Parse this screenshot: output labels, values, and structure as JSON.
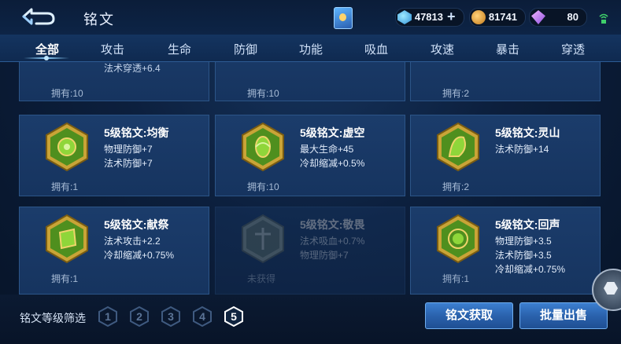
{
  "header": {
    "title": "铭文",
    "currency": [
      {
        "icon": "diamond-icon",
        "value": "47813"
      },
      {
        "icon": "gold-coin-icon",
        "value": "81741"
      },
      {
        "icon": "gem-icon",
        "value": "80"
      }
    ]
  },
  "tabs": [
    "全部",
    "攻击",
    "生命",
    "防御",
    "功能",
    "吸血",
    "攻速",
    "暴击",
    "穿透"
  ],
  "cards_top_partial": [
    {
      "stat": "法术穿透+6.4",
      "owned": "拥有:10"
    },
    {
      "owned": "拥有:10"
    },
    {
      "owned": "拥有:2"
    }
  ],
  "cards": [
    {
      "title": "5级铭文:均衡",
      "stats": [
        "物理防御+7",
        "法术防御+7"
      ],
      "owned": "拥有:1"
    },
    {
      "title": "5级铭文:虚空",
      "stats": [
        "最大生命+45",
        "冷却缩减+0.5%"
      ],
      "owned": "拥有:10"
    },
    {
      "title": "5级铭文:灵山",
      "stats": [
        "法术防御+14"
      ],
      "owned": "拥有:2"
    },
    {
      "title": "5级铭文:献祭",
      "stats": [
        "法术攻击+2.2",
        "冷却缩减+0.75%"
      ],
      "owned": "拥有:1"
    },
    {
      "title": "5级铭文:敬畏",
      "stats": [
        "法术吸血+0.7%",
        "物理防御+7"
      ],
      "owned": "未获得"
    },
    {
      "title": "5级铭文:回声",
      "stats": [
        "物理防御+3.5",
        "法术防御+3.5",
        "冷却缩减+0.75%"
      ],
      "owned": "拥有:1"
    }
  ],
  "footer": {
    "filter_label": "铭文等级筛选",
    "levels": [
      "1",
      "2",
      "3",
      "4",
      "5"
    ],
    "active_level": "5",
    "get_button": "铭文获取",
    "sell_button": "批量出售"
  }
}
